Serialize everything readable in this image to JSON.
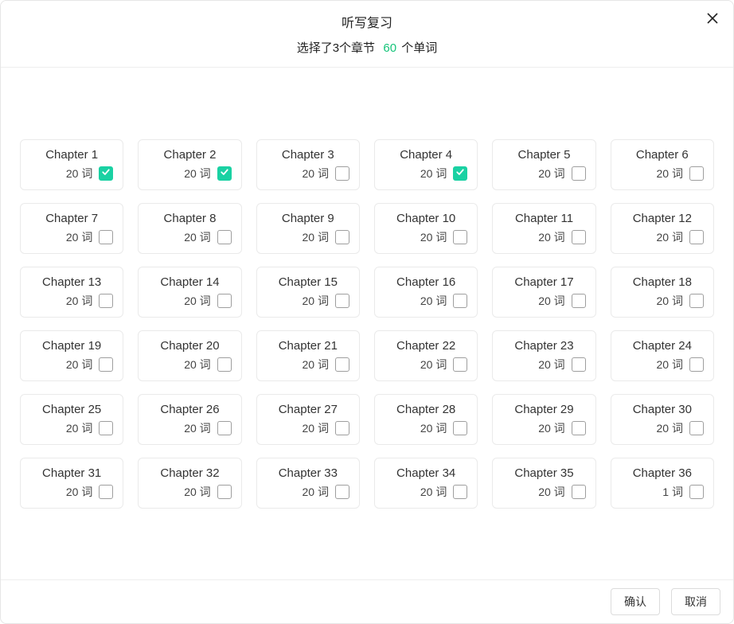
{
  "dialog": {
    "title": "听写复习",
    "subtitle_prefix": "选择了3个章节",
    "word_count": "60",
    "subtitle_suffix": "个单词"
  },
  "word_unit": "词",
  "chapters": [
    {
      "name": "Chapter 1",
      "words": 20,
      "checked": true
    },
    {
      "name": "Chapter 2",
      "words": 20,
      "checked": true
    },
    {
      "name": "Chapter 3",
      "words": 20,
      "checked": false
    },
    {
      "name": "Chapter 4",
      "words": 20,
      "checked": true
    },
    {
      "name": "Chapter 5",
      "words": 20,
      "checked": false
    },
    {
      "name": "Chapter 6",
      "words": 20,
      "checked": false
    },
    {
      "name": "Chapter 7",
      "words": 20,
      "checked": false
    },
    {
      "name": "Chapter 8",
      "words": 20,
      "checked": false
    },
    {
      "name": "Chapter 9",
      "words": 20,
      "checked": false
    },
    {
      "name": "Chapter 10",
      "words": 20,
      "checked": false
    },
    {
      "name": "Chapter 11",
      "words": 20,
      "checked": false
    },
    {
      "name": "Chapter 12",
      "words": 20,
      "checked": false
    },
    {
      "name": "Chapter 13",
      "words": 20,
      "checked": false
    },
    {
      "name": "Chapter 14",
      "words": 20,
      "checked": false
    },
    {
      "name": "Chapter 15",
      "words": 20,
      "checked": false
    },
    {
      "name": "Chapter 16",
      "words": 20,
      "checked": false
    },
    {
      "name": "Chapter 17",
      "words": 20,
      "checked": false
    },
    {
      "name": "Chapter 18",
      "words": 20,
      "checked": false
    },
    {
      "name": "Chapter 19",
      "words": 20,
      "checked": false
    },
    {
      "name": "Chapter 20",
      "words": 20,
      "checked": false
    },
    {
      "name": "Chapter 21",
      "words": 20,
      "checked": false
    },
    {
      "name": "Chapter 22",
      "words": 20,
      "checked": false
    },
    {
      "name": "Chapter 23",
      "words": 20,
      "checked": false
    },
    {
      "name": "Chapter 24",
      "words": 20,
      "checked": false
    },
    {
      "name": "Chapter 25",
      "words": 20,
      "checked": false
    },
    {
      "name": "Chapter 26",
      "words": 20,
      "checked": false
    },
    {
      "name": "Chapter 27",
      "words": 20,
      "checked": false
    },
    {
      "name": "Chapter 28",
      "words": 20,
      "checked": false
    },
    {
      "name": "Chapter 29",
      "words": 20,
      "checked": false
    },
    {
      "name": "Chapter 30",
      "words": 20,
      "checked": false
    },
    {
      "name": "Chapter 31",
      "words": 20,
      "checked": false
    },
    {
      "name": "Chapter 32",
      "words": 20,
      "checked": false
    },
    {
      "name": "Chapter 33",
      "words": 20,
      "checked": false
    },
    {
      "name": "Chapter 34",
      "words": 20,
      "checked": false
    },
    {
      "name": "Chapter 35",
      "words": 20,
      "checked": false
    },
    {
      "name": "Chapter 36",
      "words": 1,
      "checked": false
    }
  ],
  "footer": {
    "confirm": "确认",
    "cancel": "取消"
  }
}
